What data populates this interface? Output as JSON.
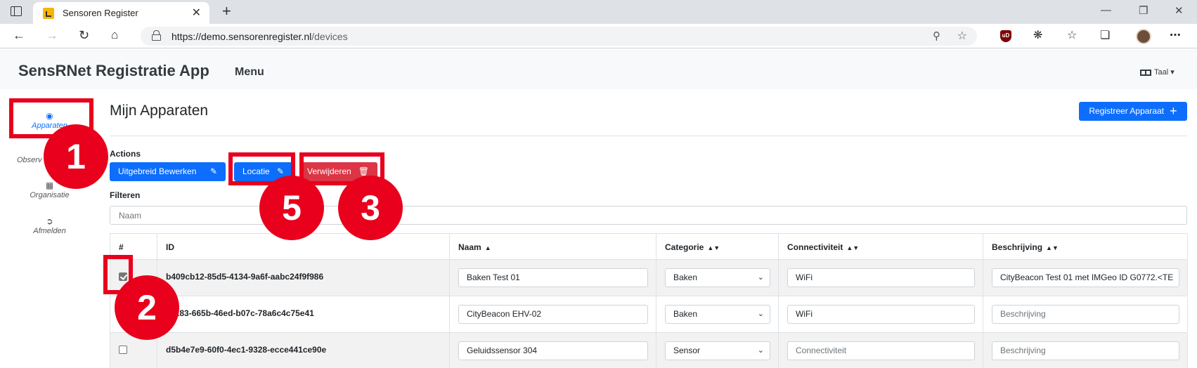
{
  "browser": {
    "tab_title": "Sensoren Register",
    "tab_close": "✕",
    "new_tab": "+",
    "url_host": "https://demo.sensorenregister.nl",
    "url_path": "/devices",
    "controls": {
      "minimize": "—",
      "restore": "❐",
      "close": "✕"
    }
  },
  "app": {
    "brand": "SensRNet Registratie App",
    "menu": "Menu",
    "language": "Taal"
  },
  "sidebar": {
    "items": [
      {
        "label": "Apparaten",
        "icon": "eye-icon",
        "active": true
      },
      {
        "label": "Observ",
        "icon": "",
        "active": false
      },
      {
        "label": "Organisatie",
        "icon": "building-icon",
        "active": false
      },
      {
        "label": "Afmelden",
        "icon": "sign-out-icon",
        "active": false
      }
    ]
  },
  "main": {
    "title": "Mijn Apparaten",
    "register_button": "Registreer Apparaat",
    "actions_label": "Actions",
    "actions": {
      "edit": "Uitgebreid Bewerken",
      "location": "Locatie",
      "delete": "Verwijderen"
    },
    "filter_label": "Filteren",
    "filter_placeholder": "Naam"
  },
  "table": {
    "headers": [
      "#",
      "ID",
      "Naam",
      "Categorie",
      "Connectiviteit",
      "Beschrijving"
    ],
    "rows": [
      {
        "checked": true,
        "id": "b409cb12-85d5-4134-9a6f-aabc24f9f986",
        "naam": "Baken Test 01",
        "categorie": "Baken",
        "connectiviteit": "WiFi",
        "connectiviteit_placeholder": false,
        "beschrijving": "CityBeacon Test 01 met IMGeo ID G0772.<TE",
        "beschrijving_placeholder": false
      },
      {
        "checked": false,
        "id": "61183-665b-46ed-b07c-78a6c4c75e41",
        "naam": "CityBeacon EHV-02",
        "categorie": "Baken",
        "connectiviteit": "WiFi",
        "connectiviteit_placeholder": false,
        "beschrijving": "Beschrijving",
        "beschrijving_placeholder": true
      },
      {
        "checked": false,
        "id": "d5b4e7e9-60f0-4ec1-9328-ecce441ce90e",
        "naam": "Geluidssensor 304",
        "categorie": "Sensor",
        "connectiviteit": "Connectiviteit",
        "connectiviteit_placeholder": true,
        "beschrijving": "Beschrijving",
        "beschrijving_placeholder": true
      }
    ]
  },
  "annotations": {
    "color": "#e8001c",
    "badges": [
      "1",
      "2",
      "3",
      "5"
    ]
  },
  "colors": {
    "primary": "#0d6efd",
    "danger": "#dc3545",
    "header_bg": "#f8f9fa"
  }
}
